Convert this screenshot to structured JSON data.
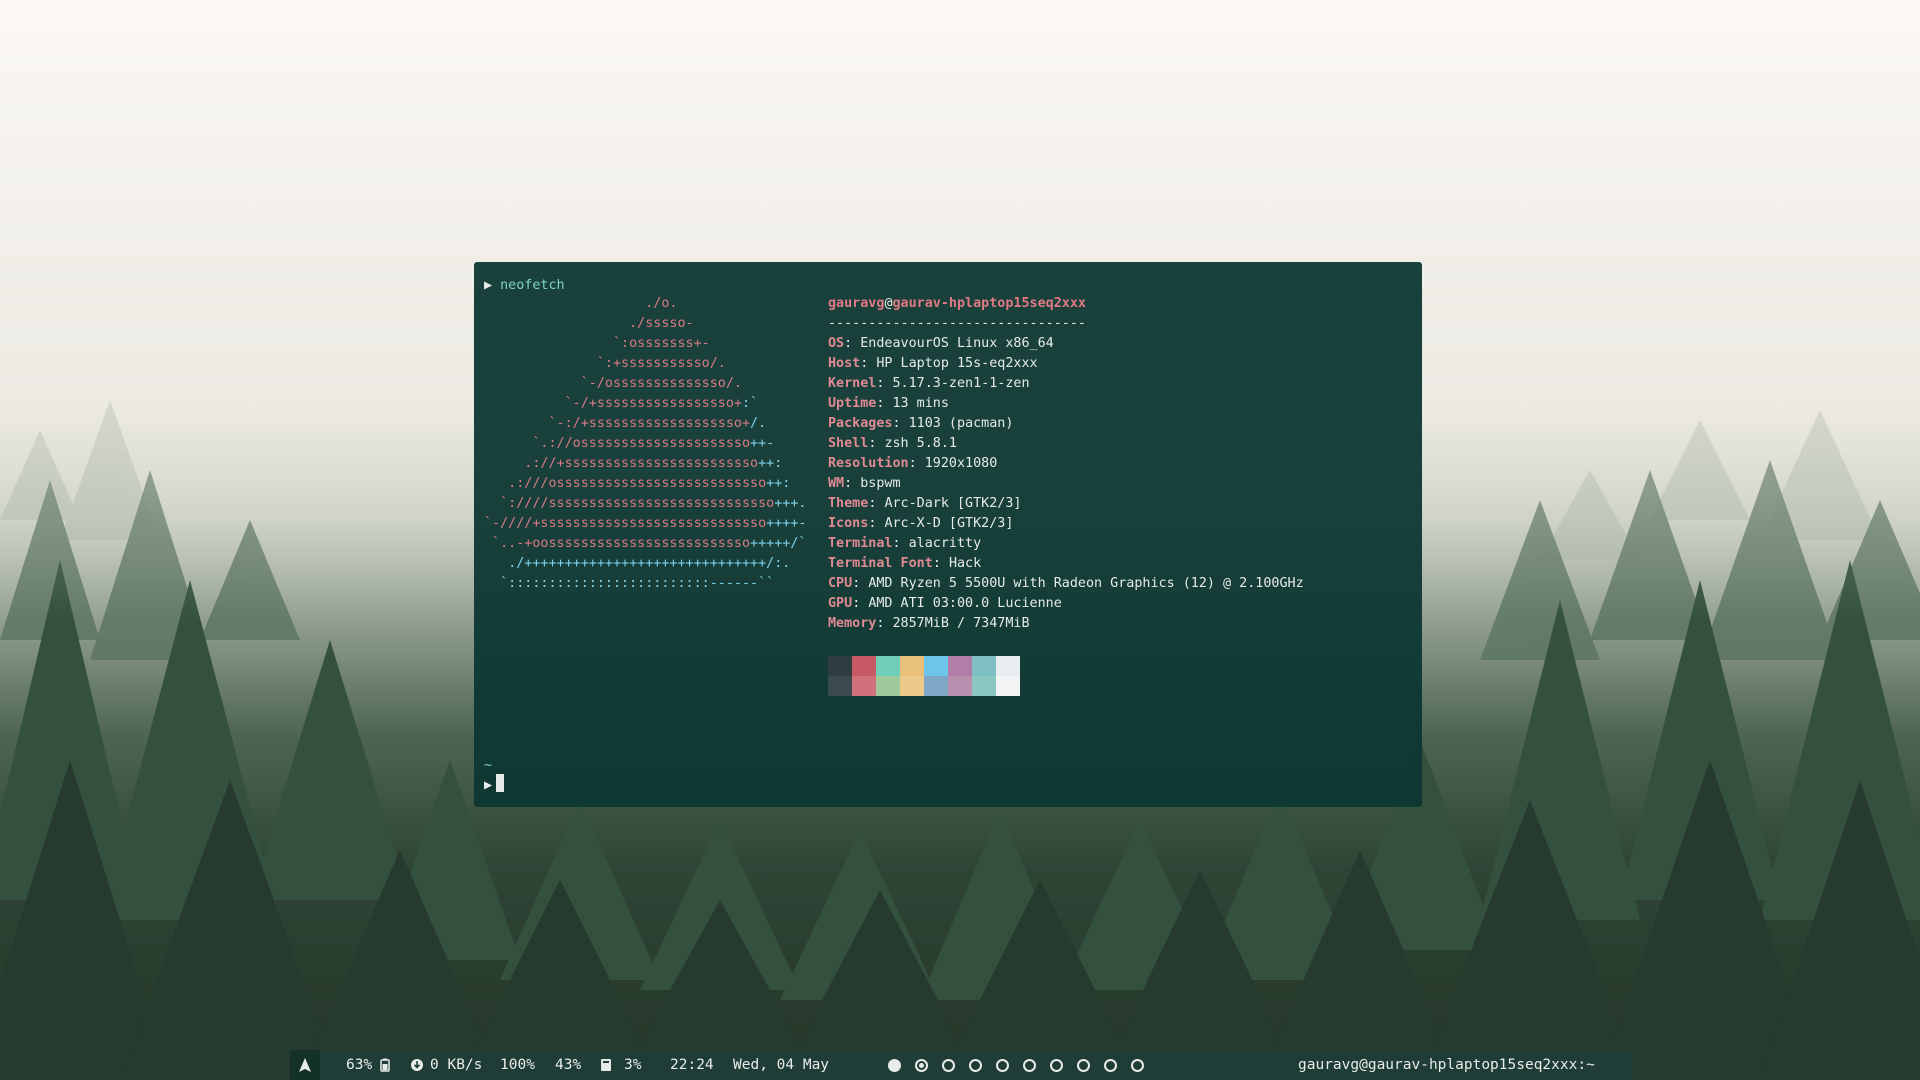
{
  "terminal": {
    "prompt_symbol": "▶",
    "command": "neofetch",
    "ascii_art": [
      {
        "r": "                    ./o.",
        "b": ""
      },
      {
        "r": "                  ./sssso-",
        "b": ""
      },
      {
        "r": "                `:osssssss+-",
        "b": ""
      },
      {
        "r": "              `:+sssssssssso/.",
        "b": ""
      },
      {
        "r": "            `-/ossssssssssssso/.",
        "b": ""
      },
      {
        "r": "          `-/+sssssssssssssssso+",
        "b": ":`"
      },
      {
        "r": "        `-:/+sssssssssssssssssso+",
        "b": "/."
      },
      {
        "r": "      `.://osssssssssssssssssssso",
        "b": "++-"
      },
      {
        "r": "     .://+ssssssssssssssssssssssso",
        "b": "++:"
      },
      {
        "r": "   .:///ossssssssssssssssssssssssso",
        "b": "++:"
      },
      {
        "r": "  `:////ssssssssssssssssssssssssssso",
        "b": "+++."
      },
      {
        "r": "`-////+ssssssssssssssssssssssssssso",
        "b": "++++-"
      },
      {
        "r": " `..-+oosssssssssssssssssssssssso",
        "b": "+++++/`"
      },
      {
        "r": "",
        "b": "   ./++++++++++++++++++++++++++++++/:."
      },
      {
        "r": "",
        "b": "  `:::::::::::::::::::::::::------``"
      }
    ],
    "user": "gauravg",
    "at": "@",
    "host": "gaurav-hplaptop15seq2xxx",
    "separator": "--------------------------------",
    "info": [
      {
        "key": "OS",
        "value": "EndeavourOS Linux x86_64"
      },
      {
        "key": "Host",
        "value": "HP Laptop 15s-eq2xxx"
      },
      {
        "key": "Kernel",
        "value": "5.17.3-zen1-1-zen"
      },
      {
        "key": "Uptime",
        "value": "13 mins"
      },
      {
        "key": "Packages",
        "value": "1103 (pacman)"
      },
      {
        "key": "Shell",
        "value": "zsh 5.8.1"
      },
      {
        "key": "Resolution",
        "value": "1920x1080"
      },
      {
        "key": "WM",
        "value": "bspwm"
      },
      {
        "key": "Theme",
        "value": "Arc-Dark [GTK2/3]"
      },
      {
        "key": "Icons",
        "value": "Arc-X-D [GTK2/3]"
      },
      {
        "key": "Terminal",
        "value": "alacritty"
      },
      {
        "key": "Terminal Font",
        "value": "Hack"
      },
      {
        "key": "CPU",
        "value": "AMD Ryzen 5 5500U with Radeon Graphics (12) @ 2.100GHz"
      },
      {
        "key": "GPU",
        "value": "AMD ATI 03:00.0 Lucienne"
      },
      {
        "key": "Memory",
        "value": "2857MiB / 7347MiB"
      }
    ],
    "palette": [
      {
        "top": "#2f3d41",
        "bottom": "#3b4a4f"
      },
      {
        "top": "#c85a66",
        "bottom": "#d0707b"
      },
      {
        "top": "#6fcfb8",
        "bottom": "#9ec99a"
      },
      {
        "top": "#e8c07a",
        "bottom": "#edc98a"
      },
      {
        "top": "#6cc6ea",
        "bottom": "#7ea6c6"
      },
      {
        "top": "#b07ea6",
        "bottom": "#b98fb0"
      },
      {
        "top": "#7ec0c4",
        "bottom": "#8bc7c2"
      },
      {
        "top": "#e9eef0",
        "bottom": "#f2f4f5"
      }
    ],
    "tilde": "~"
  },
  "statusbar": {
    "logo_icon": "arch-logo-icon",
    "battery": "63%",
    "network": "0 KB/s",
    "volume": "100%",
    "brightness": "43%",
    "cpu": "3%",
    "time": "22:24",
    "date": "Wed, 04 May",
    "workspaces": 10,
    "active_workspace": 1,
    "title": "gauravg@gaurav-hplaptop15seq2xxx:~"
  }
}
